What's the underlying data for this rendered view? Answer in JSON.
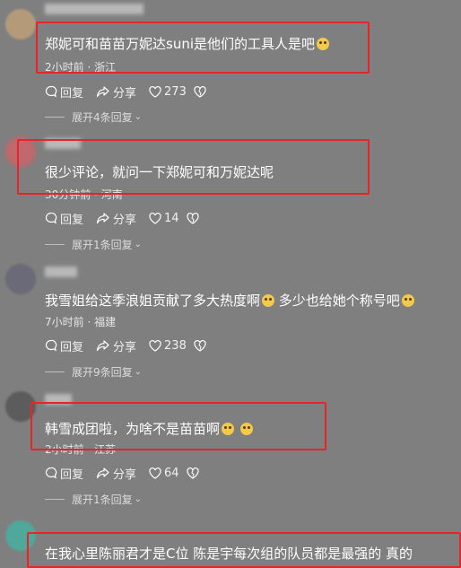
{
  "comments": [
    {
      "text": "郑妮可和苗苗万妮达suni是他们的工具人是吧",
      "meta": "2小时前 · 浙江",
      "reply_label": "回复",
      "share_label": "分享",
      "likes": "273",
      "expand": "展开4条回复"
    },
    {
      "text": "很少评论，就问一下郑妮可和万妮达呢",
      "meta": "30分钟前 · 河南",
      "reply_label": "回复",
      "share_label": "分享",
      "likes": "14",
      "expand": "展开1条回复"
    },
    {
      "text": "我雪姐给这季浪姐贡献了多大热度啊",
      "text2": "多少也给她个称号吧",
      "meta": "7小时前 · 福建",
      "reply_label": "回复",
      "share_label": "分享",
      "likes": "238",
      "expand": "展开9条回复"
    },
    {
      "text": "韩雪成团啦，为啥不是苗苗啊",
      "meta": "2小时前 · 江苏",
      "reply_label": "回复",
      "share_label": "分享",
      "likes": "64",
      "expand": "展开1条回复"
    },
    {
      "text": "在我心里陈丽君才是C位 陈是宇每次组的队员都是最强的 真的"
    }
  ],
  "colors": {
    "background": "#7f7f7f",
    "highlight_border": "#e5242c"
  }
}
